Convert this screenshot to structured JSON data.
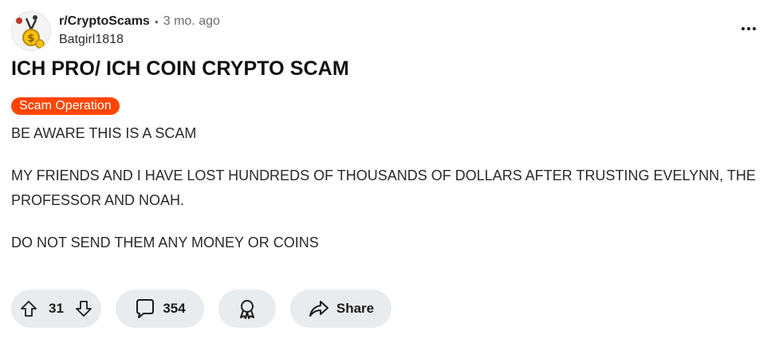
{
  "post": {
    "subreddit": "r/CryptoScams",
    "separator": "•",
    "time_ago": "3 mo. ago",
    "author": "Batgirl1818",
    "title": "ICH PRO/ ICH COIN CRYPTO SCAM",
    "flair": "Scam Operation",
    "body": [
      "BE AWARE THIS IS A SCAM",
      "MY FRIENDS AND I HAVE LOST HUNDREDS OF THOUSANDS OF DOLLARS AFTER TRUSTING EVELYNN, THE PROFESSOR AND NOAH.",
      "DO NOT SEND THEM ANY MONEY OR COINS"
    ]
  },
  "actions": {
    "votes": "31",
    "comments": "354",
    "share_label": "Share"
  },
  "colors": {
    "flair_bg": "#ff4500",
    "pill_bg": "#e9ecef"
  },
  "icons": [
    "subreddit-avatar",
    "more-icon",
    "upvote-icon",
    "downvote-icon",
    "comment-icon",
    "award-icon",
    "share-icon"
  ]
}
